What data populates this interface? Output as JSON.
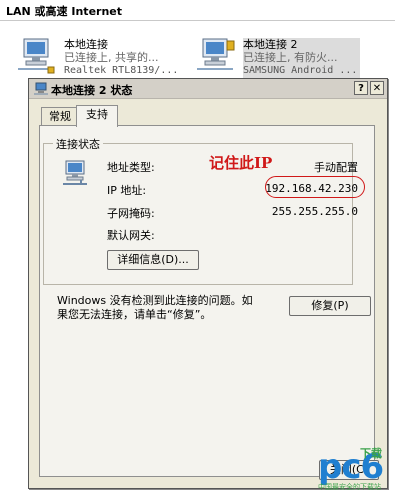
{
  "background": {
    "section_header": "LAN 或高速 Internet",
    "connections": [
      {
        "name": "本地连接",
        "status": "已连接上, 共享的...",
        "adapter": "Realtek RTL8139/..."
      },
      {
        "name": "本地连接 2",
        "status": "已连接上, 有防火...",
        "adapter": "SAMSUNG Android ..."
      }
    ]
  },
  "dialog": {
    "title": "本地连接 2 状态",
    "help_label": "?",
    "close_label": "✕",
    "tabs": [
      "常规",
      "支持"
    ],
    "group_title": "连接状态",
    "rows": [
      {
        "label": "地址类型:",
        "value": "手动配置"
      },
      {
        "label": "IP 地址:",
        "value": "192.168.42.230"
      },
      {
        "label": "子网掩码:",
        "value": "255.255.255.0"
      },
      {
        "label": "默认网关:",
        "value": ""
      }
    ],
    "details_button": "详细信息(D)...",
    "message": "Windows 没有检测到此连接的问题。如果您无法连接，请单击“修复”。",
    "repair_button": "修复(P)",
    "close_button": "关闭(C)"
  },
  "annotation": {
    "text": "记住此IP",
    "color": "#d01818"
  },
  "watermark": {
    "logo": "pc6",
    "tag": "下载",
    "subtitle": "中国最安全的下载站"
  }
}
